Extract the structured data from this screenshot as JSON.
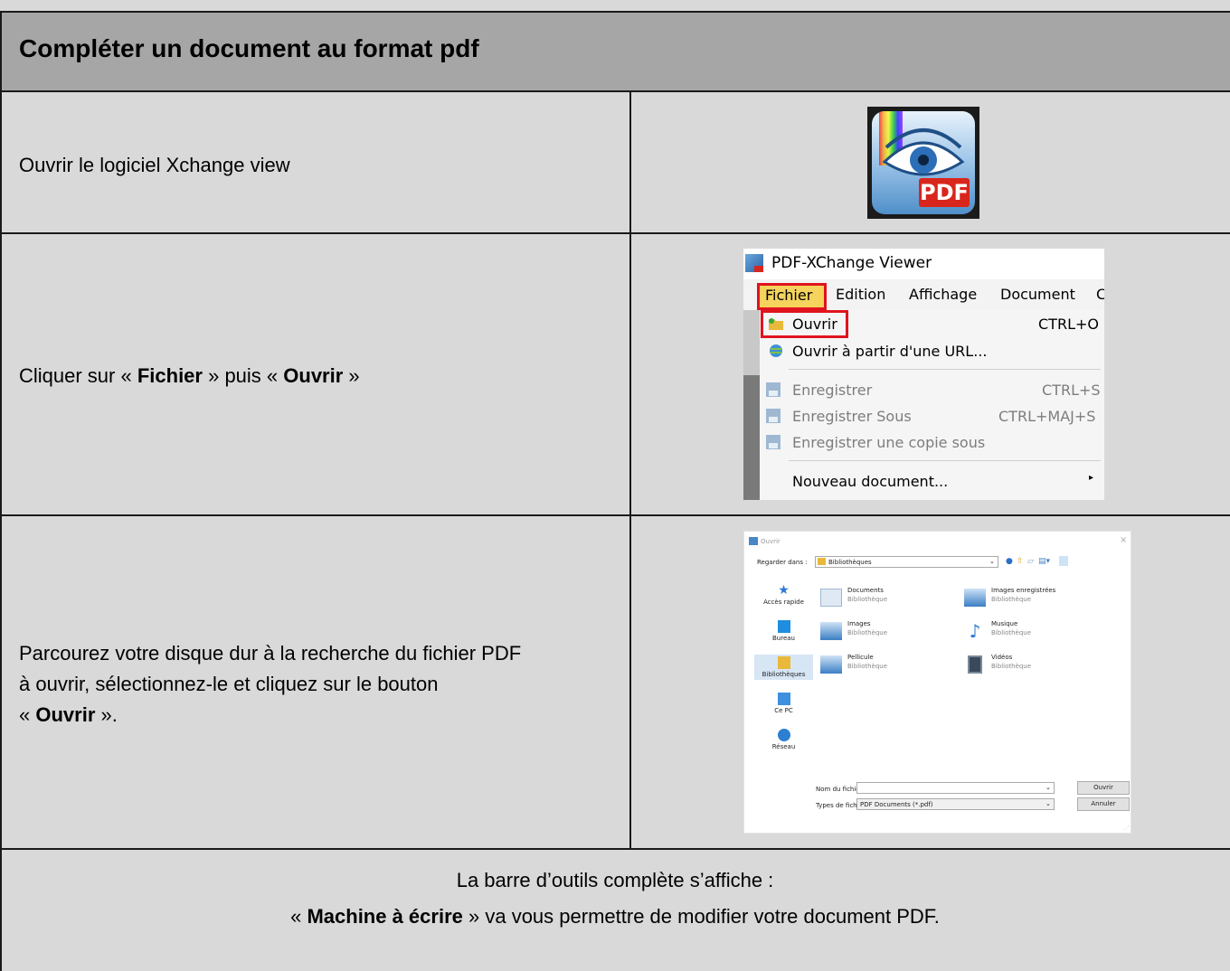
{
  "title": "Compléter un document au format pdf",
  "rows": [
    {
      "text": "Ouvrir le logiciel Xchange view"
    },
    {
      "text_prefix": "Cliquer sur « ",
      "bold1": "Fichier",
      "mid": " » puis « ",
      "bold2": "Ouvrir",
      "suffix": " »"
    },
    {
      "line1": "Parcourez votre disque dur à la recherche du fichier PDF",
      "line2": "à ouvrir, sélectionnez-le et cliquez sur le bouton",
      "line3_prefix": "« ",
      "line3_bold": "Ouvrir",
      "line3_suffix": " »."
    }
  ],
  "footer": {
    "line1": "La barre d’outils complète s’affiche :",
    "line2_prefix": "« ",
    "line2_bold": "Machine à écrire",
    "line2_suffix": " » va vous permettre de modifier votre document PDF."
  },
  "icon": {
    "badge": "PDF"
  },
  "menu_screenshot": {
    "window_title": "PDF-XChange Viewer",
    "menubar": [
      "Fichier",
      "Edition",
      "Affichage",
      "Document",
      "C"
    ],
    "items": [
      {
        "label": "Ouvrir",
        "shortcut": "CTRL+O",
        "enabled": true
      },
      {
        "label": "Ouvrir à partir d'une URL...",
        "shortcut": "",
        "enabled": true
      },
      {
        "label": "Enregistrer",
        "shortcut": "CTRL+S",
        "enabled": false
      },
      {
        "label": "Enregistrer Sous",
        "shortcut": "CTRL+MAJ+S",
        "enabled": false
      },
      {
        "label": "Enregistrer une copie sous",
        "shortcut": "",
        "enabled": false
      },
      {
        "label": "Nouveau document...",
        "shortcut": "",
        "enabled": true
      }
    ],
    "highlight_color": "#e0141e"
  },
  "dialog_screenshot": {
    "title": "Ouvrir",
    "close": "×",
    "look_in_label": "Regarder dans :",
    "look_in_value": "Bibliothèques",
    "places": [
      "Accès rapide",
      "Bureau",
      "Bibliothèques",
      "Ce PC",
      "Réseau"
    ],
    "libraries": [
      {
        "name": "Documents",
        "sub": "Bibliothèque"
      },
      {
        "name": "Images enregistrées",
        "sub": "Bibliothèque"
      },
      {
        "name": "Images",
        "sub": "Bibliothèque"
      },
      {
        "name": "Musique",
        "sub": "Bibliothèque"
      },
      {
        "name": "Pellicule",
        "sub": "Bibliothèque"
      },
      {
        "name": "Vidéos",
        "sub": "Bibliothèque"
      }
    ],
    "filename_label": "Nom du fichier :",
    "filename_value": "",
    "filetype_label": "Types de fichiers :",
    "filetype_value": "PDF Documents (*.pdf)",
    "open_button": "Ouvrir",
    "cancel_button": "Annuler"
  }
}
